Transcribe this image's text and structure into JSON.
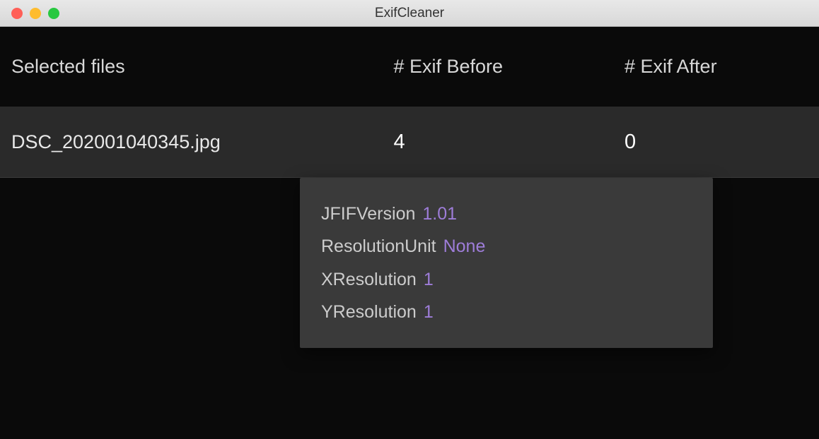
{
  "window": {
    "title": "ExifCleaner"
  },
  "headers": {
    "file": "Selected files",
    "before": "# Exif Before",
    "after": "# Exif After"
  },
  "row": {
    "filename": "DSC_202001040345.jpg",
    "before": "4",
    "after": "0"
  },
  "tooltip": {
    "items": [
      {
        "key": "JFIFVersion",
        "value": "1.01"
      },
      {
        "key": "ResolutionUnit",
        "value": "None"
      },
      {
        "key": "XResolution",
        "value": "1"
      },
      {
        "key": "YResolution",
        "value": "1"
      }
    ]
  }
}
